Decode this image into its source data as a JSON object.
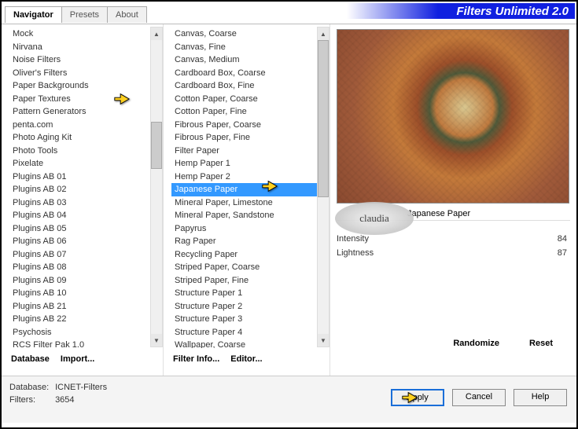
{
  "brand": "Filters Unlimited 2.0",
  "tabs": {
    "t0": "Navigator",
    "t1": "Presets",
    "t2": "About"
  },
  "col1": {
    "items": [
      "Mock",
      "Nirvana",
      "Noise Filters",
      "Oliver's Filters",
      "Paper Backgrounds",
      "Paper Textures",
      "Pattern Generators",
      "penta.com",
      "Photo Aging Kit",
      "Photo Tools",
      "Pixelate",
      "Plugins AB 01",
      "Plugins AB 02",
      "Plugins AB 03",
      "Plugins AB 04",
      "Plugins AB 05",
      "Plugins AB 06",
      "Plugins AB 07",
      "Plugins AB 08",
      "Plugins AB 09",
      "Plugins AB 10",
      "Plugins AB 21",
      "Plugins AB 22",
      "Psychosis",
      "RCS Filter Pak 1.0"
    ],
    "btn0": "Database",
    "btn1": "Import..."
  },
  "col2": {
    "items": [
      "Canvas, Coarse",
      "Canvas, Fine",
      "Canvas, Medium",
      "Cardboard Box, Coarse",
      "Cardboard Box, Fine",
      "Cotton Paper, Coarse",
      "Cotton Paper, Fine",
      "Fibrous Paper, Coarse",
      "Fibrous Paper, Fine",
      "Filter Paper",
      "Hemp Paper 1",
      "Hemp Paper 2",
      "Japanese Paper",
      "Mineral Paper, Limestone",
      "Mineral Paper, Sandstone",
      "Papyrus",
      "Rag Paper",
      "Recycling Paper",
      "Striped Paper, Coarse",
      "Striped Paper, Fine",
      "Structure Paper 1",
      "Structure Paper 2",
      "Structure Paper 3",
      "Structure Paper 4",
      "Wallpaper, Coarse"
    ],
    "selected_index": 12,
    "btn0": "Filter Info...",
    "btn1": "Editor..."
  },
  "preview": {
    "filter_name": "Japanese Paper"
  },
  "params": {
    "p0": {
      "label": "Intensity",
      "value": "84"
    },
    "p1": {
      "label": "Lightness",
      "value": "87"
    }
  },
  "right_btns": {
    "b0": "Randomize",
    "b1": "Reset"
  },
  "footer": {
    "db_label": "Database:",
    "db_value": "ICNET-Filters",
    "filters_label": "Filters:",
    "filters_value": "3654",
    "apply": "Apply",
    "cancel": "Cancel",
    "help": "Help"
  },
  "watermark": "claudia"
}
